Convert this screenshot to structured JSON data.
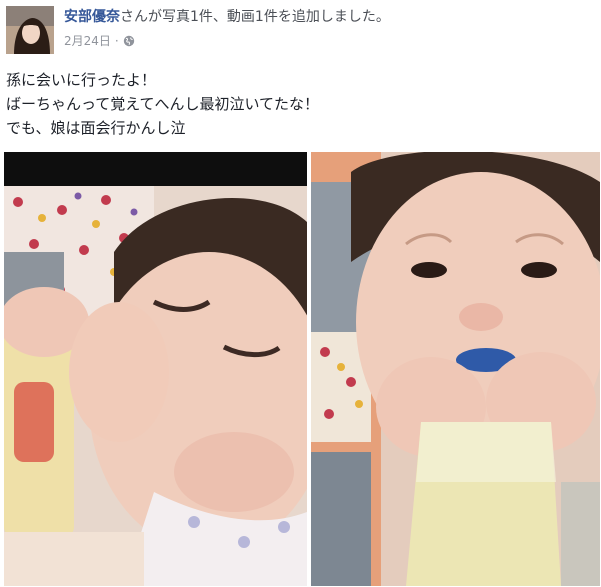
{
  "post": {
    "author": "安部優奈",
    "action": "さんが写真1件、動画1件を追加しました。",
    "date": "2月24日",
    "separator": "·",
    "privacy_icon": "globe-icon",
    "text_lines": [
      "孫に会いに行ったよ！",
      "ばーちゃんって覚えてへんし最初泣いてたな！",
      "でも、娘は面会行かんし泣"
    ]
  },
  "media": [
    {
      "kind": "photo",
      "subject": "baby drinking from bottle"
    },
    {
      "kind": "video",
      "subject": "baby holding bottle"
    }
  ],
  "colors": {
    "link": "#365899",
    "meta": "#90949c",
    "text": "#1d2129"
  }
}
